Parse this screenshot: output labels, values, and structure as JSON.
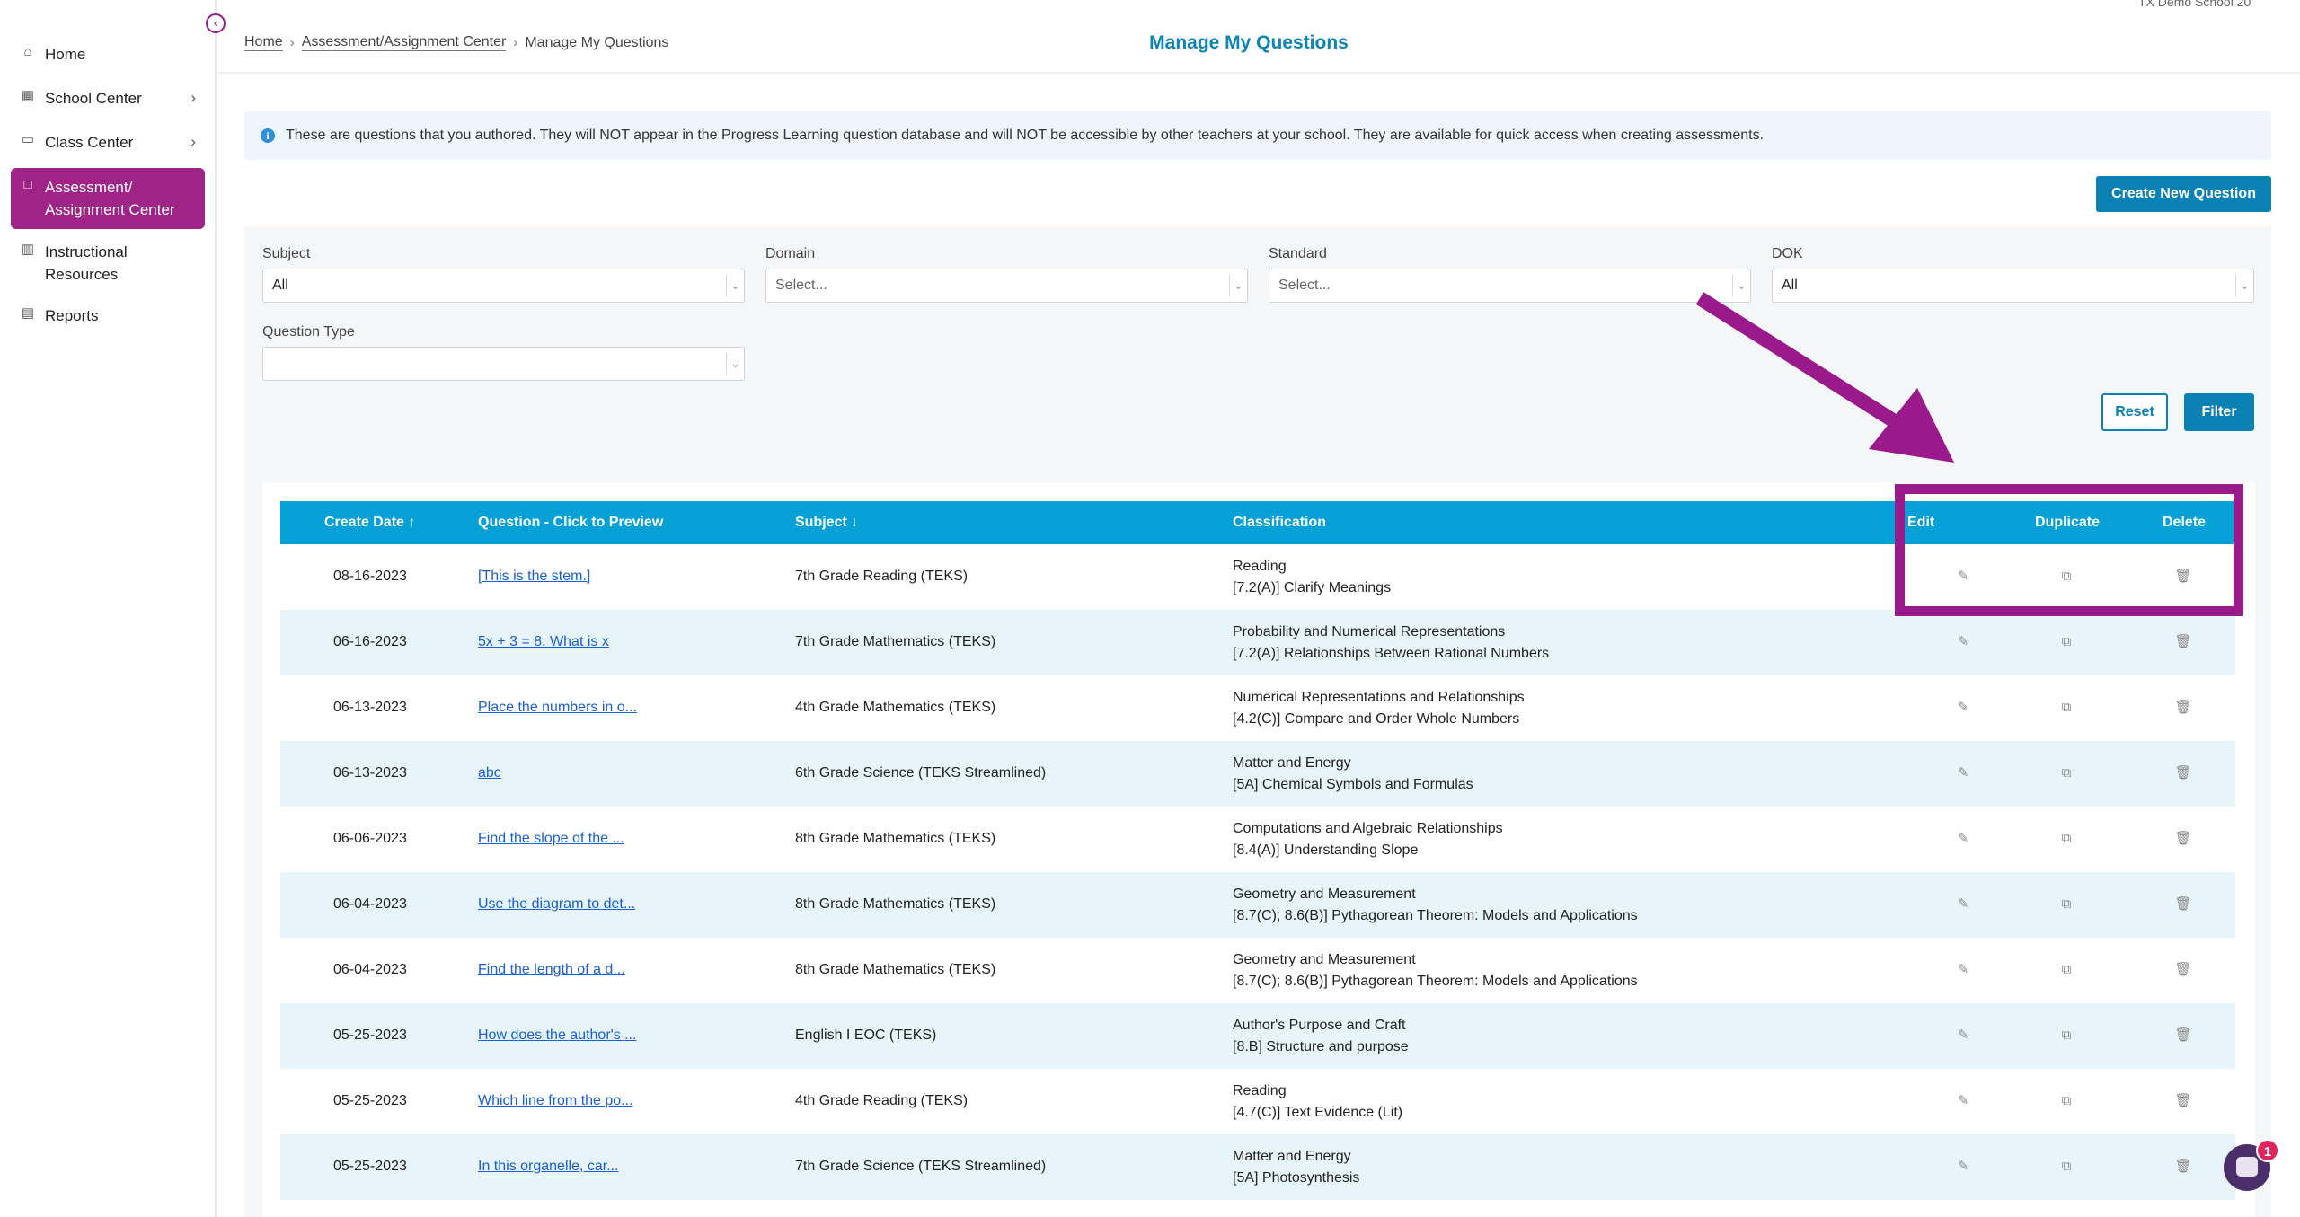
{
  "school_bar": "TX Demo School 20",
  "sidebar": {
    "collapse_icon": "arrow-left-circle-icon",
    "items": [
      {
        "label": "Home",
        "icon": "house-icon",
        "has_children": false,
        "active": false
      },
      {
        "label": "School Center",
        "icon": "school-icon",
        "has_children": true,
        "active": false
      },
      {
        "label": "Class Center",
        "icon": "classroom-icon",
        "has_children": true,
        "active": false
      },
      {
        "label": "Assessment/ Assignment Center",
        "icon": "book-open-icon",
        "has_children": false,
        "active": true
      },
      {
        "label": "Instructional Resources",
        "icon": "book-icon",
        "has_children": false,
        "active": false
      },
      {
        "label": "Reports",
        "icon": "report-icon",
        "has_children": false,
        "active": false
      }
    ]
  },
  "breadcrumb": {
    "home": "Home",
    "center": "Assessment/Assignment Center",
    "current": "Manage My Questions"
  },
  "page_title": "Manage My Questions",
  "info_banner": "These are questions that you authored. They will NOT appear in the Progress Learning question database and will NOT be accessible by other teachers at your school. They are available for quick access when creating assessments.",
  "create_button": "Create New Question",
  "filters": {
    "subject": {
      "label": "Subject",
      "value": "All"
    },
    "domain": {
      "label": "Domain",
      "placeholder": "Select..."
    },
    "standard": {
      "label": "Standard",
      "placeholder": "Select..."
    },
    "dok": {
      "label": "DOK",
      "value": "All"
    },
    "question_type": {
      "label": "Question Type",
      "value": ""
    },
    "reset_label": "Reset",
    "filter_label": "Filter"
  },
  "table": {
    "columns": {
      "create_date": "Create Date",
      "question": "Question - Click to Preview",
      "subject": "Subject",
      "classification": "Classification",
      "edit": "Edit",
      "duplicate": "Duplicate",
      "delete": "Delete"
    },
    "rows": [
      {
        "date": "08-16-2023",
        "question": "[This is the stem.]",
        "subject": "7th Grade Reading (TEKS)",
        "class_domain": "Reading",
        "class_standard": "[7.2(A)] Clarify Meanings"
      },
      {
        "date": "06-16-2023",
        "question": "5x + 3 = 8. What is x",
        "subject": "7th Grade Mathematics (TEKS)",
        "class_domain": "Probability and Numerical Representations",
        "class_standard": "[7.2(A)] Relationships Between Rational Numbers"
      },
      {
        "date": "06-13-2023",
        "question": "Place the numbers in o...",
        "subject": "4th Grade Mathematics (TEKS)",
        "class_domain": "Numerical Representations and Relationships",
        "class_standard": "[4.2(C)] Compare and Order Whole Numbers"
      },
      {
        "date": "06-13-2023",
        "question": "abc",
        "subject": "6th Grade Science (TEKS Streamlined)",
        "class_domain": "Matter and Energy",
        "class_standard": "[5A] Chemical Symbols and Formulas"
      },
      {
        "date": "06-06-2023",
        "question": "Find the slope of the ...",
        "subject": "8th Grade Mathematics (TEKS)",
        "class_domain": "Computations and Algebraic Relationships",
        "class_standard": "[8.4(A)] Understanding Slope"
      },
      {
        "date": "06-04-2023",
        "question": "Use the diagram to det...",
        "subject": "8th Grade Mathematics (TEKS)",
        "class_domain": "Geometry and Measurement",
        "class_standard": "[8.7(C); 8.6(B)] Pythagorean Theorem: Models and Applications"
      },
      {
        "date": "06-04-2023",
        "question": "Find the length of a d...",
        "subject": "8th Grade Mathematics (TEKS)",
        "class_domain": "Geometry and Measurement",
        "class_standard": "[8.7(C); 8.6(B)] Pythagorean Theorem: Models and Applications"
      },
      {
        "date": "05-25-2023",
        "question": "How does the author's ...",
        "subject": "English I EOC (TEKS)",
        "class_domain": "Author's Purpose and Craft",
        "class_standard": "[8.B] Structure and purpose"
      },
      {
        "date": "05-25-2023",
        "question": "Which line from the po...",
        "subject": "4th Grade Reading (TEKS)",
        "class_domain": "Reading",
        "class_standard": "[4.7(C)] Text Evidence (Lit)"
      },
      {
        "date": "05-25-2023",
        "question": "In this organelle, car...",
        "subject": "7th Grade Science (TEKS Streamlined)",
        "class_domain": "Matter and Energy",
        "class_standard": "[5A] Photosynthesis"
      }
    ]
  },
  "chat": {
    "badge": "1"
  },
  "colors": {
    "brand_purple": "#a02387",
    "table_header": "#04a0d6",
    "primary_button": "#0a80b3",
    "title_blue": "#0b84b8",
    "annotation": "#9a1a8c"
  }
}
